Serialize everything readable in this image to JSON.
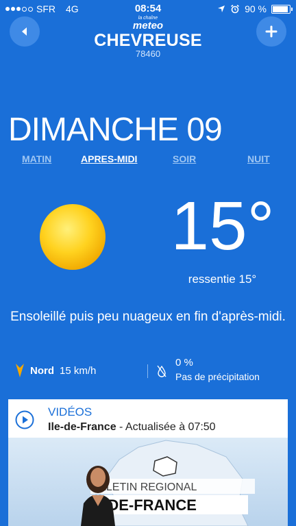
{
  "status_bar": {
    "carrier": "SFR",
    "network": "4G",
    "time": "08:54",
    "battery": "90 %",
    "battery_level": 0.9
  },
  "header": {
    "logo_text_top": "la chaîne",
    "logo_text": "meteo",
    "city": "CHEVREUSE",
    "postcode": "78460",
    "back_icon": "back-arrow-icon",
    "add_icon": "plus-icon"
  },
  "forecast": {
    "day": "DIMANCHE 09",
    "tabs": [
      {
        "label": "MATIN",
        "active": false
      },
      {
        "label": "APRES-MIDI",
        "active": true
      },
      {
        "label": "SOIR",
        "active": false
      },
      {
        "label": "NUIT",
        "active": false
      }
    ],
    "weather_icon": "sun-icon",
    "temperature": "15°",
    "feels_like": "ressentie 15°",
    "description": "Ensoleillé puis peu nuageux en fin d'après-midi.",
    "wind": {
      "direction": "Nord",
      "speed": "15 km/h"
    },
    "precipitation": {
      "value": "0 %",
      "label": "Pas de précipitation"
    }
  },
  "video": {
    "title": "VIDÉOS",
    "region": "Ile-de-France",
    "updated": " - Actualisée à 07:50",
    "thumb_line1": "LLETIN REGIONAL",
    "thumb_line2": "-DE-FRANCE"
  },
  "colors": {
    "background": "#1a6fd8",
    "accent": "#f5a800",
    "card": "#ffffff"
  }
}
